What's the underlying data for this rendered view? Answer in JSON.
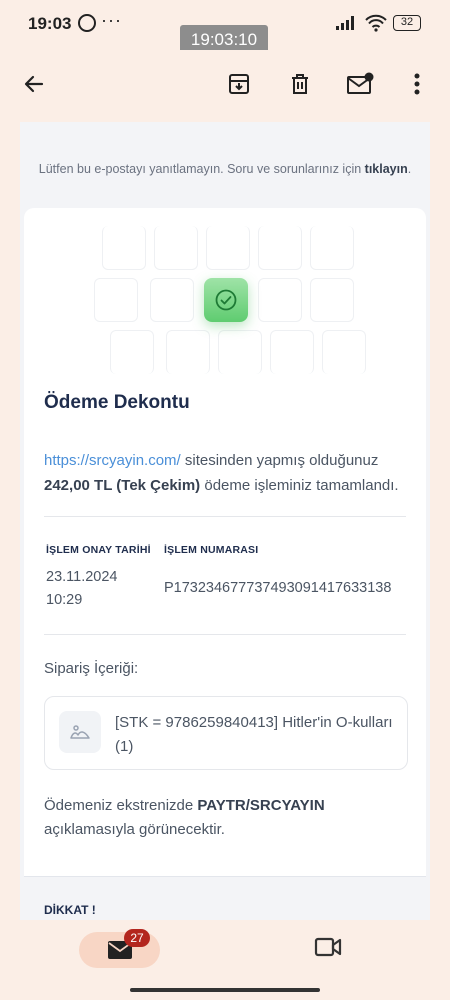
{
  "status_bar": {
    "time": "19:03",
    "more": "···",
    "battery": "32"
  },
  "screenshot_time": "19:03:10",
  "toolbar": {
    "back_icon": "arrow-left-icon",
    "archive_icon": "archive-icon",
    "delete_icon": "trash-icon",
    "unread_icon": "mail-dot-icon",
    "more_icon": "more-vert-icon"
  },
  "email": {
    "notice_prefix": "Lütfen bu e-postayı yanıtlamayın. Soru ve sorunlarınız için ",
    "notice_link": "tıklayın",
    "notice_suffix": ".",
    "title": "Ödeme Dekontu",
    "desc_link": "https://srcyayin.com/",
    "desc_after_link": " sitesinden yapmış olduğunuz ",
    "desc_amount": "242,00 TL (Tek Çekim)",
    "desc_end": " ödeme işleminiz tamamlandı.",
    "date_label": "İŞLEM ONAY TARİHİ",
    "date_value": "23.11.2024",
    "time_value": "10:29",
    "number_label": "İŞLEM NUMARASI",
    "number_value": "P17323467773749309141763​3138",
    "order_label": "Sipariş İçeriği:",
    "order_item": "[STK = 9786259840413] Hitler'in O-kulları (1)",
    "statement_prefix": "Ödemeniz ekstrenizde ",
    "statement_bold": "PAYTR/SRCYAYIN",
    "statement_suffix": " açıklamasıyla görünecektir.",
    "warning_title": "DİKKAT !"
  },
  "bottom_nav": {
    "mail_badge": "27",
    "mail_icon": "mail-icon",
    "video_icon": "video-icon"
  },
  "colors": {
    "background": "#fbeee6",
    "accent": "#f8d6c5",
    "badge": "#b3261e",
    "success": "#5fcc70",
    "link": "#4a8fd8"
  }
}
